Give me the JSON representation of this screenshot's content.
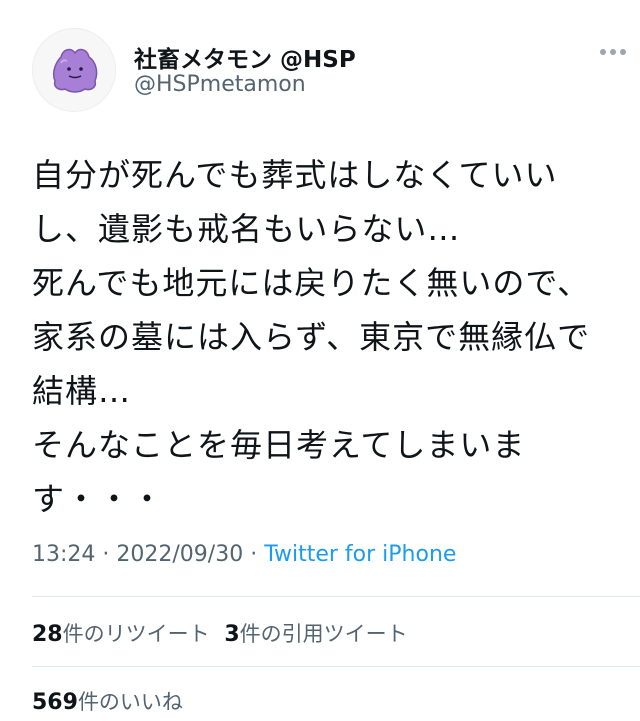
{
  "user": {
    "display_name": "社畜メタモン @HSP",
    "handle": "@HSPmetamon",
    "avatar_icon": "ditto-icon"
  },
  "tweet": {
    "lines": [
      "自分が死んでも葬式はしなくていい",
      "し、遺影も戒名もいらない…",
      "死んでも地元には戻りたく無いので、",
      "家系の墓には入らず、東京で無縁仏で",
      "結構…",
      "そんなことを毎日考えてしまいま",
      "す・・・"
    ]
  },
  "meta": {
    "time": "13:24",
    "separator": " · ",
    "date": "2022/09/30",
    "separator2": " · ",
    "source": "Twitter for iPhone"
  },
  "stats": {
    "retweets_count": "28",
    "retweets_label": "件のリツイート",
    "quotes_count": "3",
    "quotes_label": "件の引用ツイート",
    "likes_count": "569",
    "likes_label": "件のいいね"
  },
  "colors": {
    "text": "#0f1419",
    "secondary": "#536471",
    "link": "#1d9bf0",
    "avatar_purple": "#a77fd6"
  }
}
